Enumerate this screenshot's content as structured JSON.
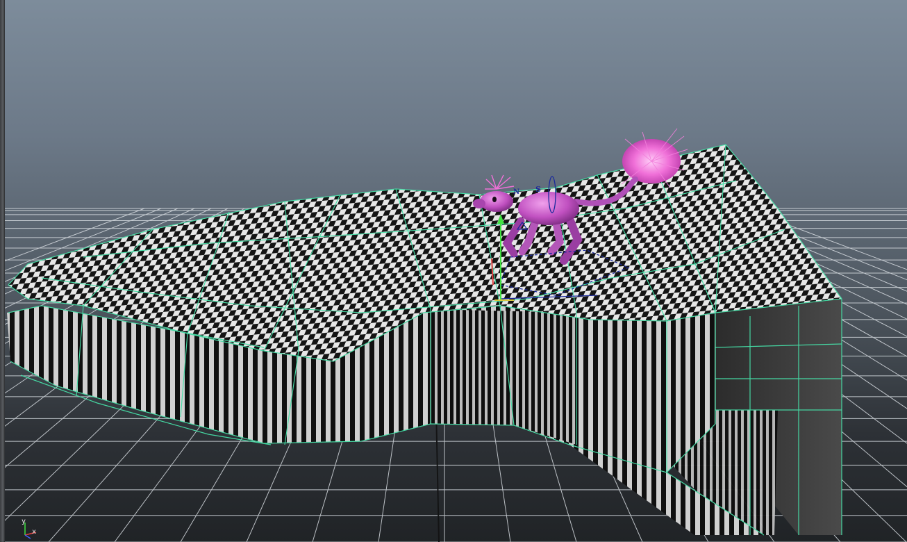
{
  "viewport": {
    "panel": "perspective",
    "background_top": "#7d8c9b",
    "background_bottom": "#202326",
    "grid_color": "#d8dde2",
    "wireframe_color": "#46e0a8"
  },
  "scene": {
    "objects": [
      {
        "name": "terrain",
        "material": "checker"
      },
      {
        "name": "character",
        "color": "#c060c8"
      }
    ],
    "manipulator_labels": [
      "N",
      "S"
    ]
  },
  "axis_indicator": {
    "x_label": "x",
    "y_label": "y",
    "x_color": "#e04040",
    "y_color": "#40e040",
    "z_color": "#4060ff"
  }
}
